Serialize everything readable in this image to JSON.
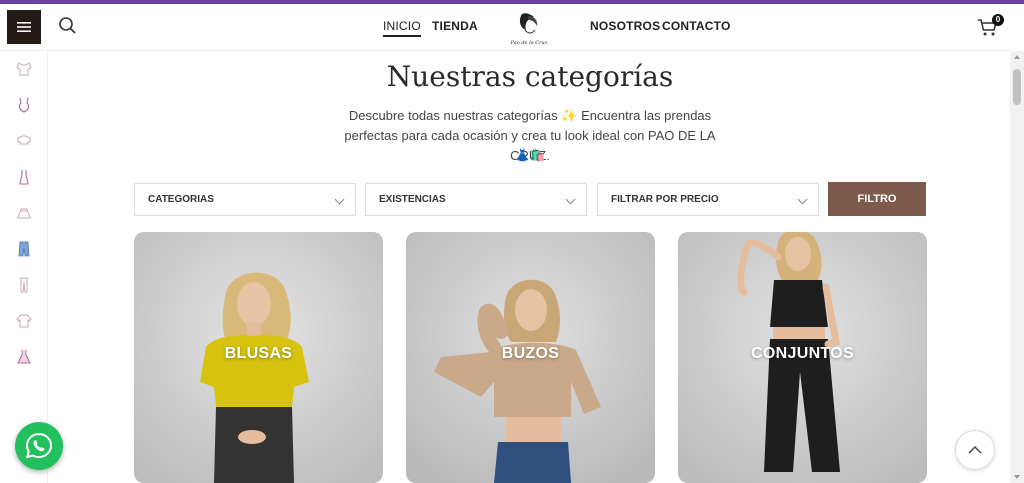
{
  "header": {
    "nav": [
      {
        "label": "INICIO"
      },
      {
        "label": "TIENDA"
      },
      {
        "label": "NOSOTROS"
      },
      {
        "label": "CONTACTO"
      }
    ],
    "logo_text": "Pao de la Cruz",
    "cart_count": "0",
    "icons": {
      "menu": "hamburger-icon",
      "search": "search-icon",
      "cart": "cart-icon"
    }
  },
  "sidebar": {
    "items": [
      {
        "icon": "top-icon"
      },
      {
        "icon": "bodysuit-icon"
      },
      {
        "icon": "crop-top-icon"
      },
      {
        "icon": "dress-icon"
      },
      {
        "icon": "skirt-icon"
      },
      {
        "icon": "jeans-icon"
      },
      {
        "icon": "pants-icon"
      },
      {
        "icon": "sweater-icon"
      },
      {
        "icon": "party-dress-icon"
      }
    ]
  },
  "main": {
    "title": "Nuestras categorías",
    "description_line1": "Descubre todas nuestras categorías ✨ Encuentra las prendas",
    "description_line2": "perfectas para cada ocasión y crea tu look ideal con PAO DE LA CRUZ.",
    "emoji_line": "👗🛍️",
    "filters": [
      {
        "label": "CATEGORIAS"
      },
      {
        "label": "EXISTENCIAS"
      },
      {
        "label": "FILTRAR POR PRECIO"
      }
    ],
    "filter_button": "FILTRO",
    "cards": [
      {
        "label": "BLUSAS",
        "garment_color": "#d6c20f"
      },
      {
        "label": "BUZOS",
        "garment_color": "#c9a98a"
      },
      {
        "label": "CONJUNTOS",
        "garment_color": "#1e1e1e"
      }
    ]
  },
  "colors": {
    "accent": "#6b3fa0",
    "button": "#7d5b4c",
    "menu_bg": "#241a16",
    "whatsapp": "#22c15e"
  }
}
